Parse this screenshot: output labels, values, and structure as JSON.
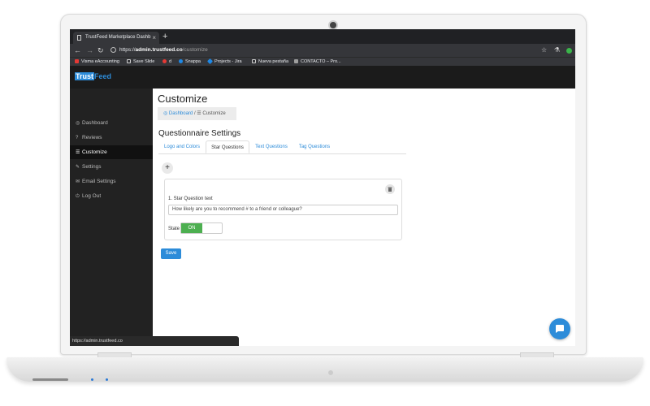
{
  "browser": {
    "tab_title": "TrustFeed Marketplace Dashb",
    "tab_close": "×",
    "new_tab": "+",
    "url_scheme": "https://",
    "url_host": "admin.trustfeed.co",
    "url_path": "/customize",
    "bookmarks": [
      {
        "label": "Visma eAccounting",
        "color": "#e53935"
      },
      {
        "label": "Save Slide",
        "color": "#cfcfcf"
      },
      {
        "label": "d",
        "color": "#e53935"
      },
      {
        "label": "Snappa",
        "color": "#1e88e5"
      },
      {
        "label": "Projects - Jira",
        "color": "#1e88e5"
      },
      {
        "label": "Nueva pestaña",
        "color": "#cfcfcf"
      },
      {
        "label": "CONTACTO – Pro...",
        "color": "#9e9e9e"
      }
    ],
    "status_url": "https://admin.trustfeed.co"
  },
  "app": {
    "logo_trust": "Trust",
    "logo_feed": "Feed",
    "brand_color": "#2d8cd9"
  },
  "sidebar": {
    "items": [
      {
        "label": "Dashboard",
        "icon": "dashboard-icon",
        "glyph": "◎"
      },
      {
        "label": "Reviews",
        "icon": "question-icon",
        "glyph": "?"
      },
      {
        "label": "Customize",
        "icon": "sliders-icon",
        "glyph": "☰"
      },
      {
        "label": "Settings",
        "icon": "wrench-icon",
        "glyph": "✎"
      },
      {
        "label": "Email Settings",
        "icon": "envelope-icon",
        "glyph": "✉"
      },
      {
        "label": "Log Out",
        "icon": "power-icon",
        "glyph": "⏻"
      }
    ],
    "active_index": 2
  },
  "main": {
    "title": "Customize",
    "breadcrumb": {
      "home": "Dashboard",
      "separator": "/",
      "current": "Customize"
    },
    "section_title": "Questionnaire Settings",
    "tabs": [
      {
        "label": "Logo and Colors"
      },
      {
        "label": "Star Questions"
      },
      {
        "label": "Text Questions"
      },
      {
        "label": "Tag Questions"
      }
    ],
    "active_tab": 1,
    "add_label": "+",
    "question": {
      "label": "1. Star Question text",
      "value": "How likely are you to recommend # to a friend or colleague?"
    },
    "state": {
      "label": "State",
      "on_label": "ON",
      "on_color": "#4caf50"
    },
    "save_label": "Save"
  }
}
